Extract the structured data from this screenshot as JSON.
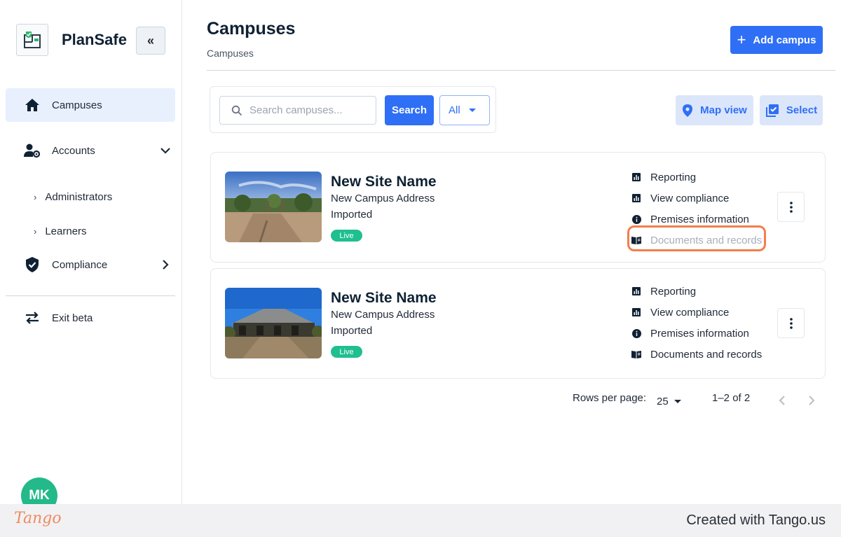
{
  "sidebar": {
    "brand": "PlanSafe",
    "collapse_icon": "double-chevron-left-icon",
    "items": [
      {
        "label": "Campuses",
        "icon": "home-icon",
        "active": true
      },
      {
        "label": "Accounts",
        "icon": "user-gear-icon",
        "expanded": true
      },
      {
        "label": "Compliance",
        "icon": "shield-check-icon",
        "expanded": false
      },
      {
        "label": "Exit beta",
        "icon": "swap-arrows-icon"
      }
    ],
    "sub_items": [
      "Administrators",
      "Learners"
    ],
    "avatar_initials": "MK"
  },
  "header": {
    "title": "Campuses",
    "breadcrumb": "Campuses",
    "add_button": "Add campus"
  },
  "search": {
    "placeholder": "Search campuses...",
    "button": "Search",
    "filter_value": "All"
  },
  "view_buttons": {
    "map": "Map view",
    "select": "Select"
  },
  "campuses": [
    {
      "name": "New Site Name",
      "address": "New Campus Address",
      "status": "Imported",
      "badge": "Live",
      "links": [
        "Reporting",
        "View compliance",
        "Premises information",
        "Documents and records"
      ]
    },
    {
      "name": "New Site Name",
      "address": "New Campus Address",
      "status": "Imported",
      "badge": "Live",
      "links": [
        "Reporting",
        "View compliance",
        "Premises information",
        "Documents and records"
      ]
    }
  ],
  "pagination": {
    "rows_label": "Rows per page:",
    "rows_value": "25",
    "range": "1–2 of 2"
  },
  "footer": {
    "logo": "Tango",
    "credit": "Created with Tango.us"
  },
  "colors": {
    "accent": "#2f6ff6",
    "live": "#1fbf8f",
    "highlight": "#f37e4a",
    "avatar": "#23b98a"
  }
}
